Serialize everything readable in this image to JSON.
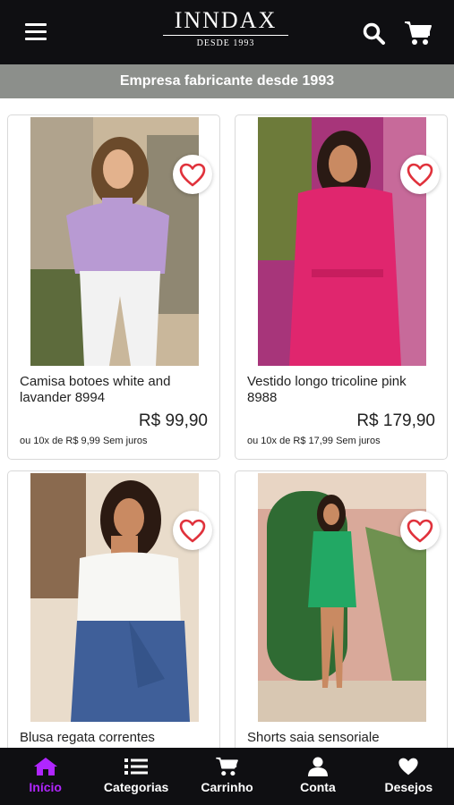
{
  "header": {
    "menu_icon": "hamburger-icon",
    "logo_name": "INNDAX",
    "logo_since": "DESDE 1993",
    "search_icon": "search-icon",
    "cart_icon": "cart-icon"
  },
  "announcement": "Empresa fabricante desde 1993",
  "colors": {
    "header_bg": "#0f0f12",
    "banner_bg": "#8c8f8b",
    "active_nav": "#b026ff",
    "heart": "#e0323c"
  },
  "products": [
    {
      "name": "Camisa botoes white and lavander 8994",
      "price": "R$ 99,90",
      "installments": "ou 10x de R$ 9,99 Sem juros"
    },
    {
      "name": "Vestido longo tricoline pink 8988",
      "price": "R$ 179,90",
      "installments": "ou 10x de R$ 17,99 Sem juros"
    },
    {
      "name": "Blusa regata correntes"
    },
    {
      "name": "Shorts saia sensoriale"
    }
  ],
  "nav": [
    {
      "label": "Início",
      "icon": "home-icon",
      "active": true
    },
    {
      "label": "Categorias",
      "icon": "list-icon"
    },
    {
      "label": "Carrinho",
      "icon": "cart-icon"
    },
    {
      "label": "Conta",
      "icon": "user-icon"
    },
    {
      "label": "Desejos",
      "icon": "heart-icon"
    }
  ]
}
